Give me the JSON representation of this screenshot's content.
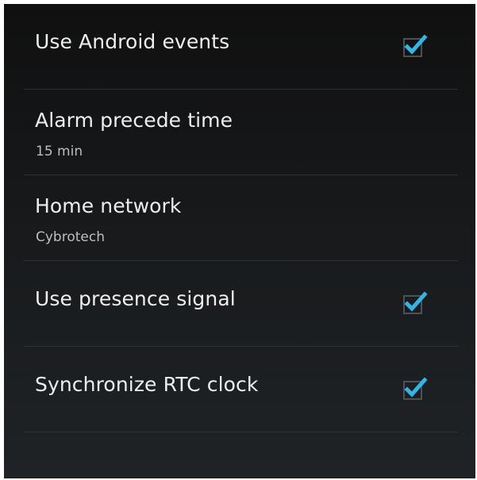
{
  "settings": {
    "items": [
      {
        "title": "Use Android events",
        "type": "checkbox",
        "checked": true
      },
      {
        "title": "Alarm precede time",
        "summary": "15 min",
        "type": "value"
      },
      {
        "title": "Home network",
        "summary": "Cybrotech",
        "type": "value"
      },
      {
        "title": "Use presence signal",
        "type": "checkbox",
        "checked": true
      },
      {
        "title": "Synchronize RTC clock",
        "type": "checkbox",
        "checked": true
      }
    ]
  },
  "colors": {
    "accent": "#33b5e5",
    "background": "#17191b",
    "title_text": "#eeeeee",
    "summary_text": "#bdbdbd",
    "divider": "#2e3134"
  },
  "icons": {
    "checkbox": "checkbox-checked-icon"
  }
}
